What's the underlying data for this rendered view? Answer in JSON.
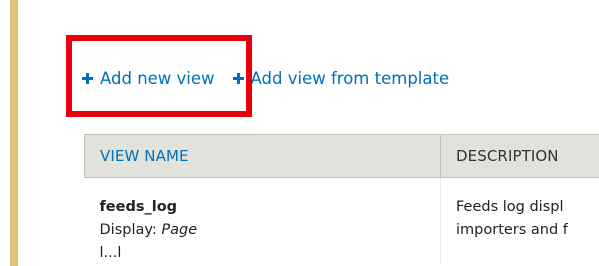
{
  "actions": {
    "add_new_view": "Add new view",
    "add_view_from_template": "Add view from template"
  },
  "table": {
    "columns": [
      "VIEW NAME",
      "DESCRIPTION"
    ],
    "rows": [
      {
        "name": "feeds_log",
        "display_label": "Display:",
        "display_value": "Page",
        "partial_line": "l...l",
        "description_line1": "Feeds log displ",
        "description_line2": "importers and f"
      }
    ]
  },
  "colors": {
    "link": "#0071b8",
    "header_background": "#e1e2dc",
    "highlight": "#e8000b",
    "left_bar": "#e3c074"
  }
}
